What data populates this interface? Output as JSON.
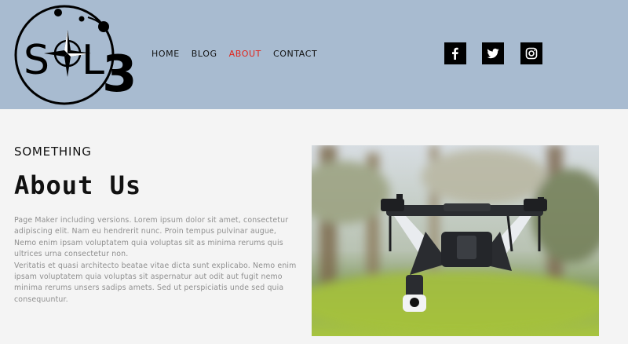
{
  "logo": {
    "text_1": "S",
    "text_2": "L",
    "text_3": "3"
  },
  "nav": {
    "items": [
      {
        "label": "HOME",
        "active": false
      },
      {
        "label": "BLOG",
        "active": false
      },
      {
        "label": "ABOUT",
        "active": true
      },
      {
        "label": "CONTACT",
        "active": false
      }
    ]
  },
  "social": [
    "facebook-icon",
    "twitter-icon",
    "instagram-icon"
  ],
  "about": {
    "eyebrow": "SOMETHING",
    "title": "About Us",
    "paragraph_1": "Page Maker including versions. Lorem ipsum dolor sit amet, consectetur adipiscing elit. Nam eu hendrerit nunc. Proin tempus pulvinar augue, Nemo enim ipsam voluptatem quia voluptas sit as minima rerums quis ultrices urna consectetur non.",
    "paragraph_2": "Veritatis et quasi architecto beatae vitae dicta sunt explicabo. Nemo enim ipsam voluptatem quia voluptas sit aspernatur aut odit aut fugit nemo minima rerums unsers sadips amets. Sed ut perspiciatis unde sed quia consequuntur."
  },
  "colors": {
    "header_bg": "#a8bbd0",
    "active_nav": "#e2231a",
    "page_bg": "#f4f4f4"
  }
}
